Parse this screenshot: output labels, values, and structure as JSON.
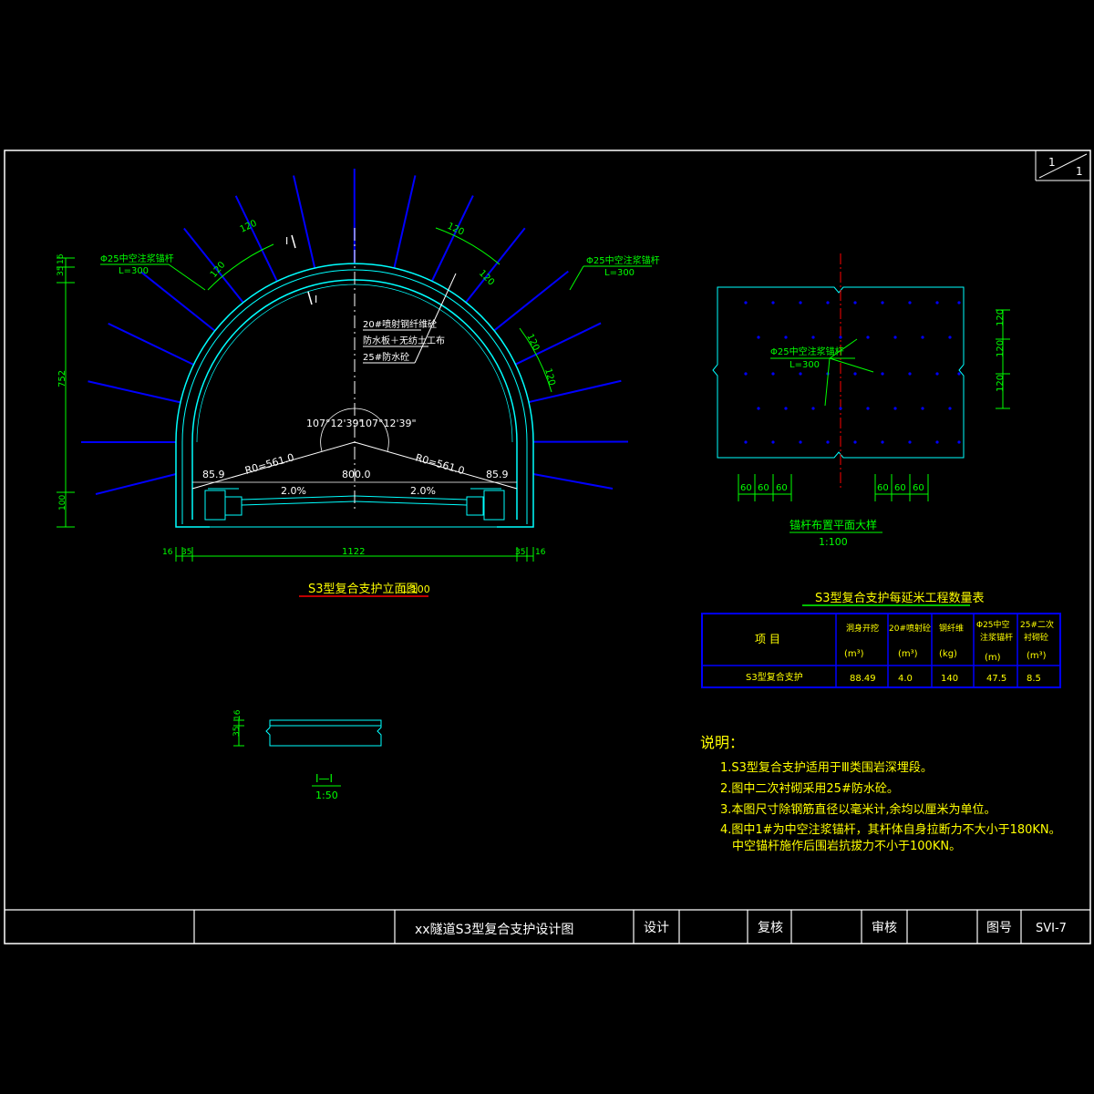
{
  "sheet": {
    "page_num": "1",
    "page_total": "1"
  },
  "section": {
    "anchor_left": {
      "title": "Φ25中空注浆锚杆",
      "length": "L=300"
    },
    "anchor_right": {
      "title": "Φ25中空注浆锚杆",
      "length": "L=300"
    },
    "spacing_labels": [
      "120",
      "120",
      "120",
      "120",
      "120",
      "120"
    ],
    "layers": [
      "20#喷射钢纤维砼",
      "防水板＋无纺土工布",
      "25#防水砼"
    ],
    "angle_left": "107°12'39\"",
    "angle_right": "107°12'39\"",
    "radius_left": "R0=561.0",
    "radius_right": "R0=561.0",
    "width_inner": "800.0",
    "offset_left": "85.9",
    "offset_right": "85.9",
    "slope_left": "2.0%",
    "slope_right": "2.0%",
    "height_dims": [
      "16",
      "35",
      "752",
      "100"
    ],
    "bottom_dims": [
      "16",
      "35",
      "1122",
      "35",
      "16"
    ],
    "cut_mark": "I",
    "title": "S3型复合支护立面图",
    "scale": "1:100"
  },
  "plan": {
    "anchor": {
      "title": "Φ25中空注浆锚杆",
      "length": "L=300"
    },
    "right_dims": [
      "120",
      "120",
      "120"
    ],
    "bottom_dims_left": [
      "60",
      "60",
      "60"
    ],
    "bottom_dims_right": [
      "60",
      "60",
      "60"
    ],
    "title": "锚杆布置平面大样",
    "scale": "1:100"
  },
  "detail": {
    "dims": [
      "16",
      "35"
    ],
    "title": "I—I",
    "scale": "1:50"
  },
  "table": {
    "title": "S3型复合支护每延米工程数量表",
    "col_item": "项  目",
    "headers": [
      {
        "name": "洞身开挖",
        "unit": "(m³)"
      },
      {
        "name": "20#喷射砼",
        "unit": "(m³)"
      },
      {
        "name": "钢纤维",
        "unit": "(kg)"
      },
      {
        "name": "Φ25中空注浆锚杆",
        "unit": "(m)"
      },
      {
        "name": "25#二次衬砌砼",
        "unit": "(m³)"
      }
    ],
    "row_label": "S3型复合支护",
    "values": [
      "88.49",
      "4.0",
      "140",
      "47.5",
      "8.5"
    ]
  },
  "notes": {
    "heading": "说明：",
    "items": [
      "1.S3型复合支护适用于Ⅲ类围岩深埋段。",
      "2.图中二次衬砌采用25#防水砼。",
      "3.本图尺寸除钢筋直径以毫米计,余均以厘米为单位。",
      "4.图中1#为中空注浆锚杆，其杆体自身拉断力不大小于180KN。",
      "中空锚杆施作后围岩抗拔力不小于100KN。"
    ]
  },
  "titleblock": {
    "drawing_title": "xx隧道S3型复合支护设计图",
    "design": "设计",
    "review": "复核",
    "approve": "审核",
    "drawing_no_label": "图号",
    "drawing_no": "SVI-7"
  },
  "colors": {
    "frame": "#ffffff",
    "tunnel": "#00ffff",
    "anchor": "#0000ff",
    "dimension": "#00ff00",
    "text": "#ffffff",
    "note": "#ffff00",
    "centerline": "#ff0000",
    "table_border": "#0000ff"
  }
}
